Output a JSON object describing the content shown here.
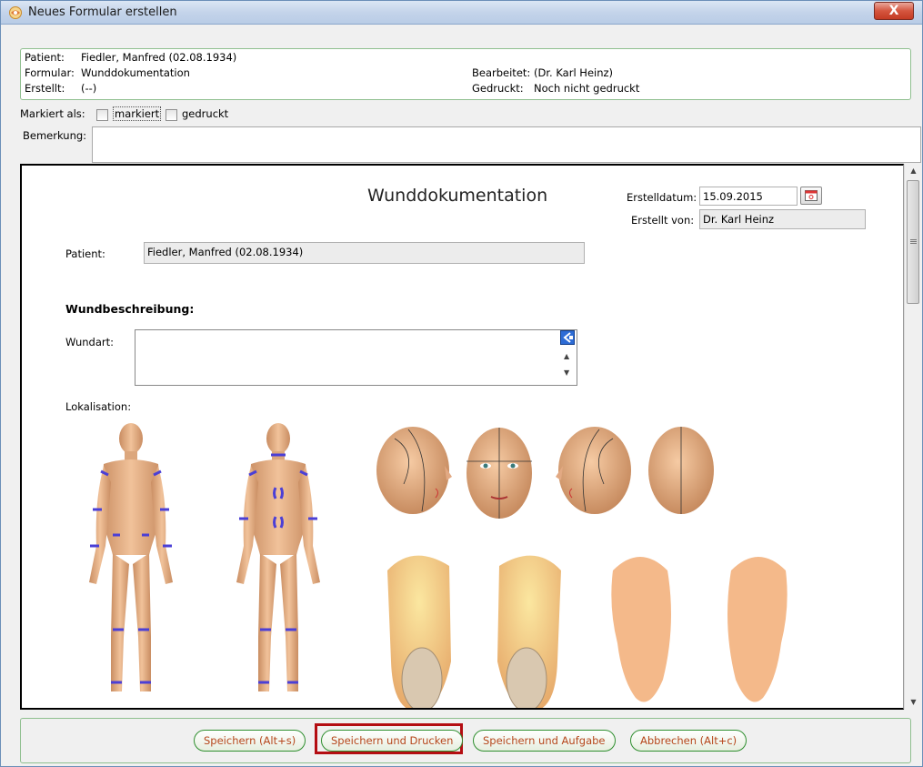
{
  "window": {
    "title": "Neues Formular erstellen",
    "close_label": "X"
  },
  "info": {
    "patient_label": "Patient:",
    "patient_value": "Fiedler, Manfred (02.08.1934)",
    "formular_label": "Formular:",
    "formular_value": "Wunddokumentation",
    "erstellt_label": "Erstellt:",
    "erstellt_value": "(--)",
    "bearbeitet_label": "Bearbeitet:",
    "bearbeitet_value": "(Dr. Karl Heinz)",
    "gedruckt_label": "Gedruckt:",
    "gedruckt_value": "Noch nicht gedruckt"
  },
  "marked": {
    "label": "Markiert als:",
    "option1": "markiert",
    "option2": "gedruckt"
  },
  "bemerkung": {
    "label": "Bemerkung:",
    "value": ""
  },
  "form": {
    "title": "Wunddokumentation",
    "erstelldatum_label": "Erstelldatum:",
    "erstelldatum_value": "15.09.2015",
    "erstellt_von_label": "Erstellt von:",
    "erstellt_von_value": "Dr. Karl Heinz",
    "patient_label": "Patient:",
    "patient_value": "Fiedler, Manfred (02.08.1934)",
    "section_heading": "Wundbeschreibung:",
    "wundart_label": "Wundart:",
    "wundart_value": "",
    "lokalisation_label": "Lokalisation:"
  },
  "buttons": {
    "save": "Speichern (Alt+s)",
    "save_print": "Speichern und Drucken",
    "save_task": "Speichern und Aufgabe",
    "cancel": "Abbrechen (Alt+c)"
  },
  "colors": {
    "frame_border": "#8fbf8f",
    "button_text": "#b6471c",
    "highlight": "#b40d12",
    "skin": "#e9b88d",
    "marker": "#4b3fd6"
  }
}
